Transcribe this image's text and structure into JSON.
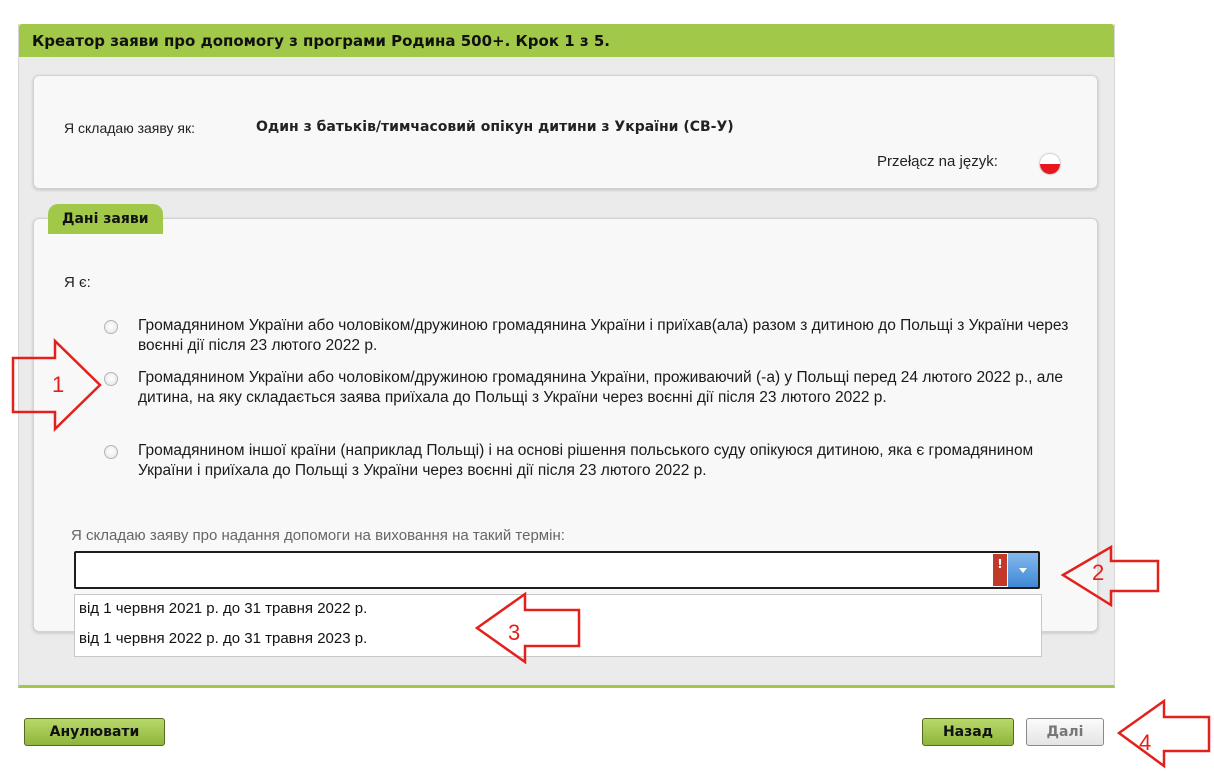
{
  "wizard": {
    "title": "Креатор заяви про допомогу з програми Родина 500+. Крок 1 з 5.",
    "accent_color": "#a2c84a"
  },
  "applicant": {
    "label": "Я складаю заяву як:",
    "value": "Один з батьків/тимчасовий опікун дитини з України (СВ-У)",
    "language_switch_label": "Przełącz na język:",
    "language_flag_icon": "poland-flag-icon"
  },
  "application_data": {
    "section_title": "Дані заяви",
    "iam_label": "Я є:",
    "options": [
      {
        "text": "Громадянином України або чоловіком/дружиною громадянина України і приїхав(ала) разом з дитиною до Польщі з України через воєнні дії після 23 лютого 2022 р.",
        "selected": false
      },
      {
        "text": "Громадянином України або чоловіком/дружиною громадянина України, проживаючий (-а) у Польщі перед 24 лютого 2022 р., але дитина, на яку складається заява приїхала до Польщі з України через воєнні дії після 23 лютого 2022 р.",
        "selected": false
      },
      {
        "text": "Громадянином іншої країни (наприклад Польщі) і на основі рішення польського суду опікуюся дитиною, яка є громадянином України і приїхала до Польщі з України через воєнні дії після 23 лютого 2022 р.",
        "selected": false
      }
    ],
    "term_label": "Я складаю заяву про надання допомоги на виховання на такий термін:",
    "term_value": "",
    "term_error_icon": "!",
    "term_options": [
      "від 1 червня 2021 р. до 31 травня 2022 р.",
      "від 1 червня 2022 р. до 31 травня 2023 р."
    ]
  },
  "buttons": {
    "cancel": "Анулювати",
    "back": "Назад",
    "next": "Далі"
  },
  "annotations": {
    "callouts": [
      "1",
      "2",
      "3",
      "4"
    ],
    "arrow_color": "#e3211c"
  }
}
